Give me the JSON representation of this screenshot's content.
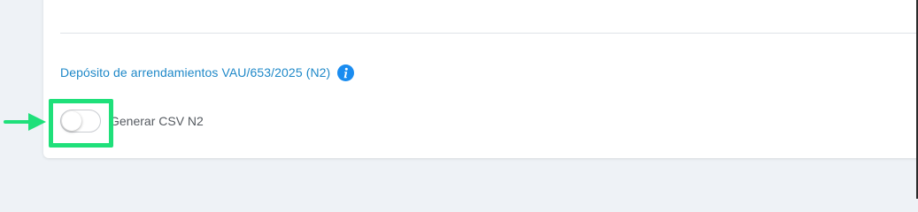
{
  "section": {
    "title": "Depósito de arrendamientos VAU/653/2025 (N2)",
    "info_icon": "info-icon"
  },
  "toggle": {
    "label": "Generar CSV N2",
    "state": "off"
  },
  "annotation": {
    "highlight_color": "#1fe07a",
    "arrow_icon": "arrow-right-icon"
  },
  "colors": {
    "accent": "#1e88c8",
    "info_icon_bg": "#1a8cf0",
    "background": "#eef2f6"
  }
}
